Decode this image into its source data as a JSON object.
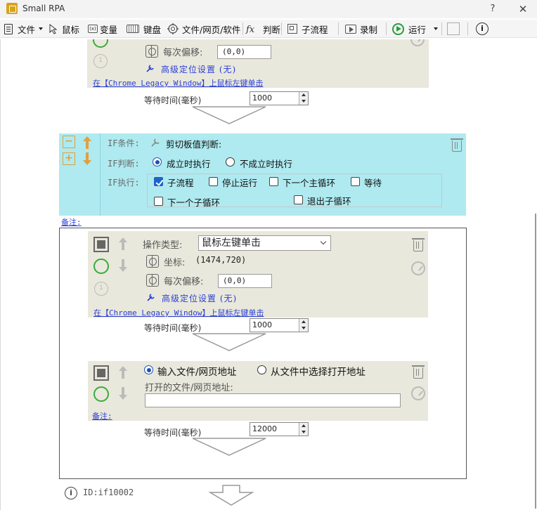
{
  "window": {
    "title": "Small RPA",
    "help": "?",
    "close": "✕"
  },
  "toolbar": {
    "file": "文件",
    "mouse": "鼠标",
    "variable": "变量",
    "keyboard": "键盘",
    "file_web_software": "文件/网页/软件",
    "judge": "判断",
    "subprocess": "子流程",
    "record": "录制",
    "run": "运行"
  },
  "top_block": {
    "offset_label": "每次偏移:",
    "offset_value": "(0,0)",
    "advanced": "高级定位设置  (无)",
    "note": "在【Chrome Legacy Window】上鼠标左键单击"
  },
  "wait1": {
    "label": "等待时间(毫秒)",
    "value": "1000"
  },
  "if_block": {
    "condition_label": "IF条件:",
    "condition_value": "剪切板值判断:",
    "judge_label": "IF判断:",
    "judge_true": "成立时执行",
    "judge_false": "不成立时执行",
    "exec_label": "IF执行:",
    "exec_options": [
      "子流程",
      "停止运行",
      "下一个主循环",
      "等待",
      "下一个子循环",
      "退出子循环"
    ],
    "note": "备注:"
  },
  "click_block": {
    "op_type_label": "操作类型:",
    "op_type_value": "鼠标左键单击",
    "coord_label": "坐标:",
    "coord_value": "(1474,720)",
    "offset_label": "每次偏移:",
    "offset_value": "(0,0)",
    "advanced": "高级定位设置  (无)",
    "note": "在【Chrome Legacy Window】上鼠标左键单击"
  },
  "wait2": {
    "label": "等待时间(毫秒)",
    "value": "1000"
  },
  "open_block": {
    "option_input": "输入文件/网页地址",
    "option_select": "从文件中选择打开地址",
    "address_label": "打开的文件/网页地址:",
    "address_value": "",
    "note": "备注:"
  },
  "wait3": {
    "label": "等待时间(毫秒)",
    "value": "12000"
  },
  "footer": {
    "id": "ID:if10002"
  }
}
